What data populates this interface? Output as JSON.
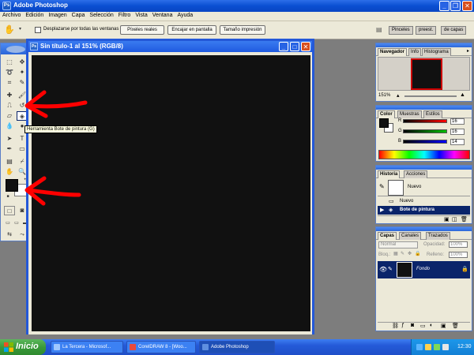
{
  "app": {
    "title": "Adobe Photoshop",
    "icon": "photoshop-logo-icon"
  },
  "menu": [
    "Archivo",
    "Edición",
    "Imagen",
    "Capa",
    "Selección",
    "Filtro",
    "Vista",
    "Ventana",
    "Ayuda"
  ],
  "options": {
    "scroll_all": "Desplazarse por todas las ventanas",
    "actual_pixels": "Píxeles reales",
    "fit_screen": "Encajar en pantalla",
    "print_size": "Tamaño impresión",
    "tab_brushes": "Pinceles",
    "tab_presets": "preest.",
    "tab_layer_comps": "de capas"
  },
  "document": {
    "title": "Sin título-1 al 151% (RGB/8)",
    "canvas_color": "#111111"
  },
  "tooltip": "Herramienta Bote de pintura (G)",
  "navigator": {
    "tabs": [
      "Navegador",
      "Info",
      "Histograma"
    ],
    "zoom": "151%"
  },
  "color_panel": {
    "tabs": [
      "Color",
      "Muestras",
      "Estilos"
    ],
    "channels": [
      {
        "label": "R",
        "value": "16"
      },
      {
        "label": "G",
        "value": "16"
      },
      {
        "label": "B",
        "value": "14"
      }
    ]
  },
  "history": {
    "tabs": [
      "Historia",
      "Acciones"
    ],
    "snapshot": "Nuevo",
    "items": [
      {
        "label": "Nuevo",
        "selected": false
      },
      {
        "label": "Bote de pintura",
        "selected": true
      }
    ]
  },
  "layers": {
    "tabs": [
      "Capas",
      "Canales",
      "Trazados"
    ],
    "blend_mode": "Normal",
    "opacity_label": "Opacidad:",
    "opacity_value": "100%",
    "lock_label": "Bloq.:",
    "fill_label": "Relleno:",
    "fill_value": "100%",
    "layer_name": "Fondo"
  },
  "taskbar": {
    "start": "Inicio",
    "buttons": [
      {
        "label": "La Tercera - Microsof...",
        "active": false
      },
      {
        "label": "CorelDRAW 8 - [Woo...",
        "active": false
      },
      {
        "label": "Adobe Photoshop",
        "active": true
      }
    ],
    "clock": "12:30"
  },
  "colors": {
    "accent": "#2458d8",
    "arrow": "#ff0000",
    "foreground": "#111111",
    "background": "#ffffff"
  }
}
